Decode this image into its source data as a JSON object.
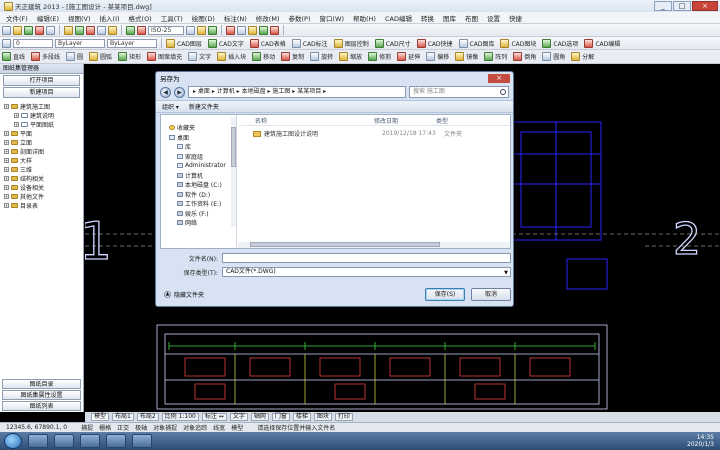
{
  "app": {
    "title": "天正建筑 2013 - [施工图设计 - 某某项目.dwg]",
    "window_controls": [
      "_",
      "□",
      "×"
    ]
  },
  "menu": [
    "文件(F)",
    "编辑(E)",
    "视图(V)",
    "插入(I)",
    "格式(O)",
    "工具(T)",
    "绘图(D)",
    "标注(N)",
    "修改(M)",
    "参数(P)",
    "窗口(W)",
    "帮助(H)",
    "CAD编辑",
    "转换",
    "图库",
    "布图",
    "设置",
    "快捷"
  ],
  "toolbar1": {
    "items": [
      "新建",
      "打开",
      "保存",
      "打印",
      "多段线",
      "编辑",
      "拷贝",
      "粘贴",
      "消隐",
      "渲染",
      "图层",
      "特性",
      "线型",
      "文字样式",
      "标注样式",
      "表格",
      "外部参照",
      "块",
      "测量",
      "帮助"
    ],
    "combo": "ISO-25"
  },
  "toolbar2": {
    "combo1": "0",
    "combo2": "ByLayer",
    "combo3": "ByLayer",
    "items": [
      "CAD图层",
      "CAD文字",
      "CAD表格",
      "CAD标注",
      "图层控制",
      "CAD尺寸",
      "CAD快捷",
      "CAD图库",
      "CAD图块",
      "CAD选项",
      "CAD编辑"
    ]
  },
  "toolbar3": {
    "items": [
      "直线",
      "多段线",
      "圆",
      "圆弧",
      "矩形",
      "图案填充",
      "文字",
      "插入块",
      "移动",
      "复制",
      "旋转",
      "缩放",
      "修剪",
      "延伸",
      "偏移",
      "镜像",
      "阵列",
      "倒角",
      "圆角",
      "分解"
    ]
  },
  "leftpanel": {
    "header": "图纸集管理器",
    "btn1": "打开项目",
    "btn2": "新建项目",
    "tree": [
      {
        "label": "建筑施工图",
        "level": 0
      },
      {
        "label": "建筑说明",
        "level": 1
      },
      {
        "label": "平面图纸",
        "level": 1
      },
      {
        "label": "平面",
        "level": 0
      },
      {
        "label": "立面",
        "level": 0
      },
      {
        "label": "剖面详图",
        "level": 0
      },
      {
        "label": "大样",
        "level": 0
      },
      {
        "label": "三维",
        "level": 0
      },
      {
        "label": "结构相关",
        "level": 0
      },
      {
        "label": "设备相关",
        "level": 0
      },
      {
        "label": "其他文件",
        "level": 0
      },
      {
        "label": "目录表",
        "level": 0
      }
    ],
    "bottom": [
      "图纸目录",
      "图纸集属性设置",
      "图纸列表"
    ]
  },
  "canvas": {
    "bg": "#000000",
    "drawing_color": "#c8d0ff",
    "grid_color": "#3b2cff",
    "label_left": "1",
    "label_right": "2"
  },
  "dialog": {
    "title": "另存为",
    "breadcrumb": "▸ 桌面 ▸ 计算机 ▸ 本地磁盘 ▸ 施工图 ▸ 某某项目 ▸",
    "search_placeholder": "搜索 施工图",
    "cmd_organize": "组织 ▾",
    "cmd_newfolder": "新建文件夹",
    "nav": [
      {
        "label": "收藏夹",
        "icon": "star",
        "sub": false
      },
      {
        "label": "桌面",
        "icon": "folder",
        "sub": false
      },
      {
        "label": "库",
        "icon": "folder",
        "sub": true
      },
      {
        "label": "家庭组",
        "icon": "folder",
        "sub": true
      },
      {
        "label": "Administrator",
        "icon": "folder",
        "sub": true
      },
      {
        "label": "计算机",
        "icon": "drive",
        "sub": true
      },
      {
        "label": "本地磁盘 (C:)",
        "icon": "drive",
        "sub": true
      },
      {
        "label": "软件 (D:)",
        "icon": "drive",
        "sub": true
      },
      {
        "label": "工作资料 (E:)",
        "icon": "drive",
        "sub": true
      },
      {
        "label": "娱乐 (F:)",
        "icon": "drive",
        "sub": true
      },
      {
        "label": "网络",
        "icon": "drive",
        "sub": true
      }
    ],
    "columns": {
      "name": "名称",
      "date": "修改日期",
      "type": "类型"
    },
    "files": [
      {
        "name": "建筑施工图设计说明",
        "date": "2019/12/18 17:43",
        "type": "文件夹"
      }
    ],
    "filename_label": "文件名(N):",
    "filename_value": "",
    "filetype_label": "保存类型(T):",
    "filetype_value": "CAD文件(*.DWG)",
    "hide_folders": "隐藏文件夹",
    "save_label": "保存(S)",
    "cancel_label": "取消"
  },
  "tabbar": [
    "模型",
    "布局1",
    "布局2",
    "比例 1:100",
    "标注 ↔",
    "文字",
    "轴网",
    "门窗",
    "楼梯",
    "图块",
    "打印"
  ],
  "status": {
    "coords": "12345.6, 67890.1, 0",
    "items": [
      "捕捉",
      "栅格",
      "正交",
      "极轴",
      "对象捕捉",
      "对象追踪",
      "线宽",
      "模型"
    ],
    "message": "请选择保存位置并输入文件名"
  },
  "clock": {
    "time": "14:35",
    "date": "2020/1/3"
  }
}
